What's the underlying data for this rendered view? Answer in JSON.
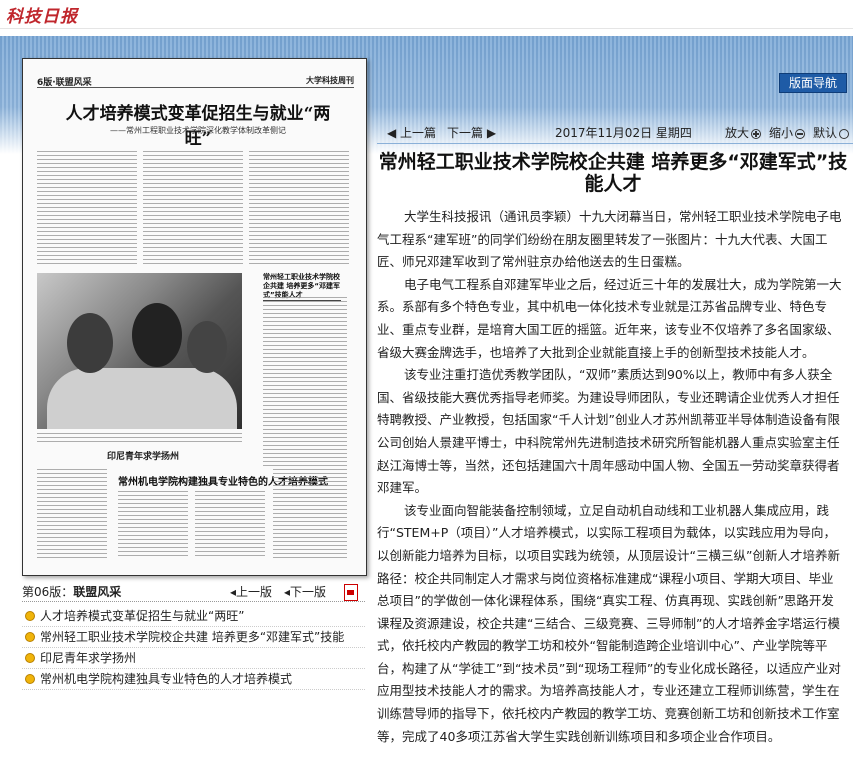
{
  "header": {
    "logo_text": "科技日报"
  },
  "nav": {
    "label": "版面导航"
  },
  "page_image": {
    "section_label": "6版·联盟风采",
    "paper_name": "大学科技周刊",
    "headline": "人才培养模式变革促招生与就业“两旺”",
    "subhead": "——常州工程职业技术学院深化教学体制改革侧记",
    "photo_caption": "印尼青年求学扬州",
    "lower_headline": "常州机电学院构建独具专业特色的人才培养模式"
  },
  "page_controls": {
    "edition_prefix": "第06版：",
    "edition_name": "联盟风采",
    "prev_label": "上一版",
    "next_label": "下一版",
    "pdf_icon": "pdf-icon"
  },
  "article_list": [
    "人才培养模式变革促招生与就业“两旺”",
    "常州轻工职业技术学院校企共建 培养更多“邓建军式”技能",
    "印尼青年求学扬州",
    "常州机电学院构建独具专业特色的人才培养模式"
  ],
  "toolbar": {
    "prev_article": "◀ 上一篇",
    "next_article": "下一篇 ▶",
    "date": "2017年11月02日  星期四",
    "zoom_in": "放大",
    "zoom_out": "缩小",
    "zoom_default": "默认"
  },
  "article": {
    "title": "常州轻工职业技术学院校企共建 培养更多“邓建军式”技能人才",
    "paragraphs": [
      "大学生科技报讯（通讯员李颖）十九大闭幕当日，常州轻工职业技术学院电子电气工程系“建军班”的同学们纷纷在朋友圈里转发了一张图片：十九大代表、大国工匠、师兄邓建军收到了常州驻京办给他送去的生日蛋糕。",
      "电子电气工程系自邓建军毕业之后，经过近三十年的发展壮大，成为学院第一大系。系部有多个特色专业，其中机电一体化技术专业就是江苏省品牌专业、特色专业、重点专业群，是培育大国工匠的摇篮。近年来，该专业不仅培养了多名国家级、省级大赛金牌选手，也培养了大批到企业就能直接上手的创新型技术技能人才。",
      "该专业注重打造优秀教学团队，“双师”素质达到90%以上，教师中有多人获全国、省级技能大赛优秀指导老师奖。为建设导师团队，专业还聘请企业优秀人才担任特聘教授、产业教授，包括国家“千人计划”创业人才苏州凯蒂亚半导体制造设备有限公司创始人景建平博士，中科院常州先进制造技术研究所智能机器人重点实验室主任赵江海博士等，当然，还包括建国六十周年感动中国人物、全国五一劳动奖章获得者邓建军。",
      "该专业面向智能装备控制领域，立足自动机自动线和工业机器人集成应用，践行“STEM+P（项目）”人才培养模式，以实际工程项目为载体，以实践应用为导向，以创新能力培养为目标，以项目实践为统领，从顶层设计“三横三纵”创新人才培养新路径：校企共同制定人才需求与岗位资格标准建成“课程小项目、学期大项目、毕业总项目”的学做创一体化课程体系，围绕“真实工程、仿真再现、实践创新”思路开发课程及资源建设，校企共建“三结合、三级竞赛、三导师制”的人才培养金字塔运行模式，依托校内产教园的教学工坊和校外“智能制造跨企业培训中心”、产业学院等平台，构建了从“学徒工”到“技术员”到“现场工程师”的专业化成长路径，以适应产业对应用型技术技能人才的需求。为培养高技能人才，专业还建立工程师训练营，学生在训练营导师的指导下，依托校内产教园的教学工坊、竞赛创新工坊和创新技术工作室等，完成了40多项江苏省大学生实践创新训练项目和多项企业合作项目。"
    ]
  },
  "colors": {
    "nav_bg": "#1e5ba6",
    "band": "#79a7d6",
    "logo": "#c0272d",
    "bullet": "#f0b40a"
  }
}
